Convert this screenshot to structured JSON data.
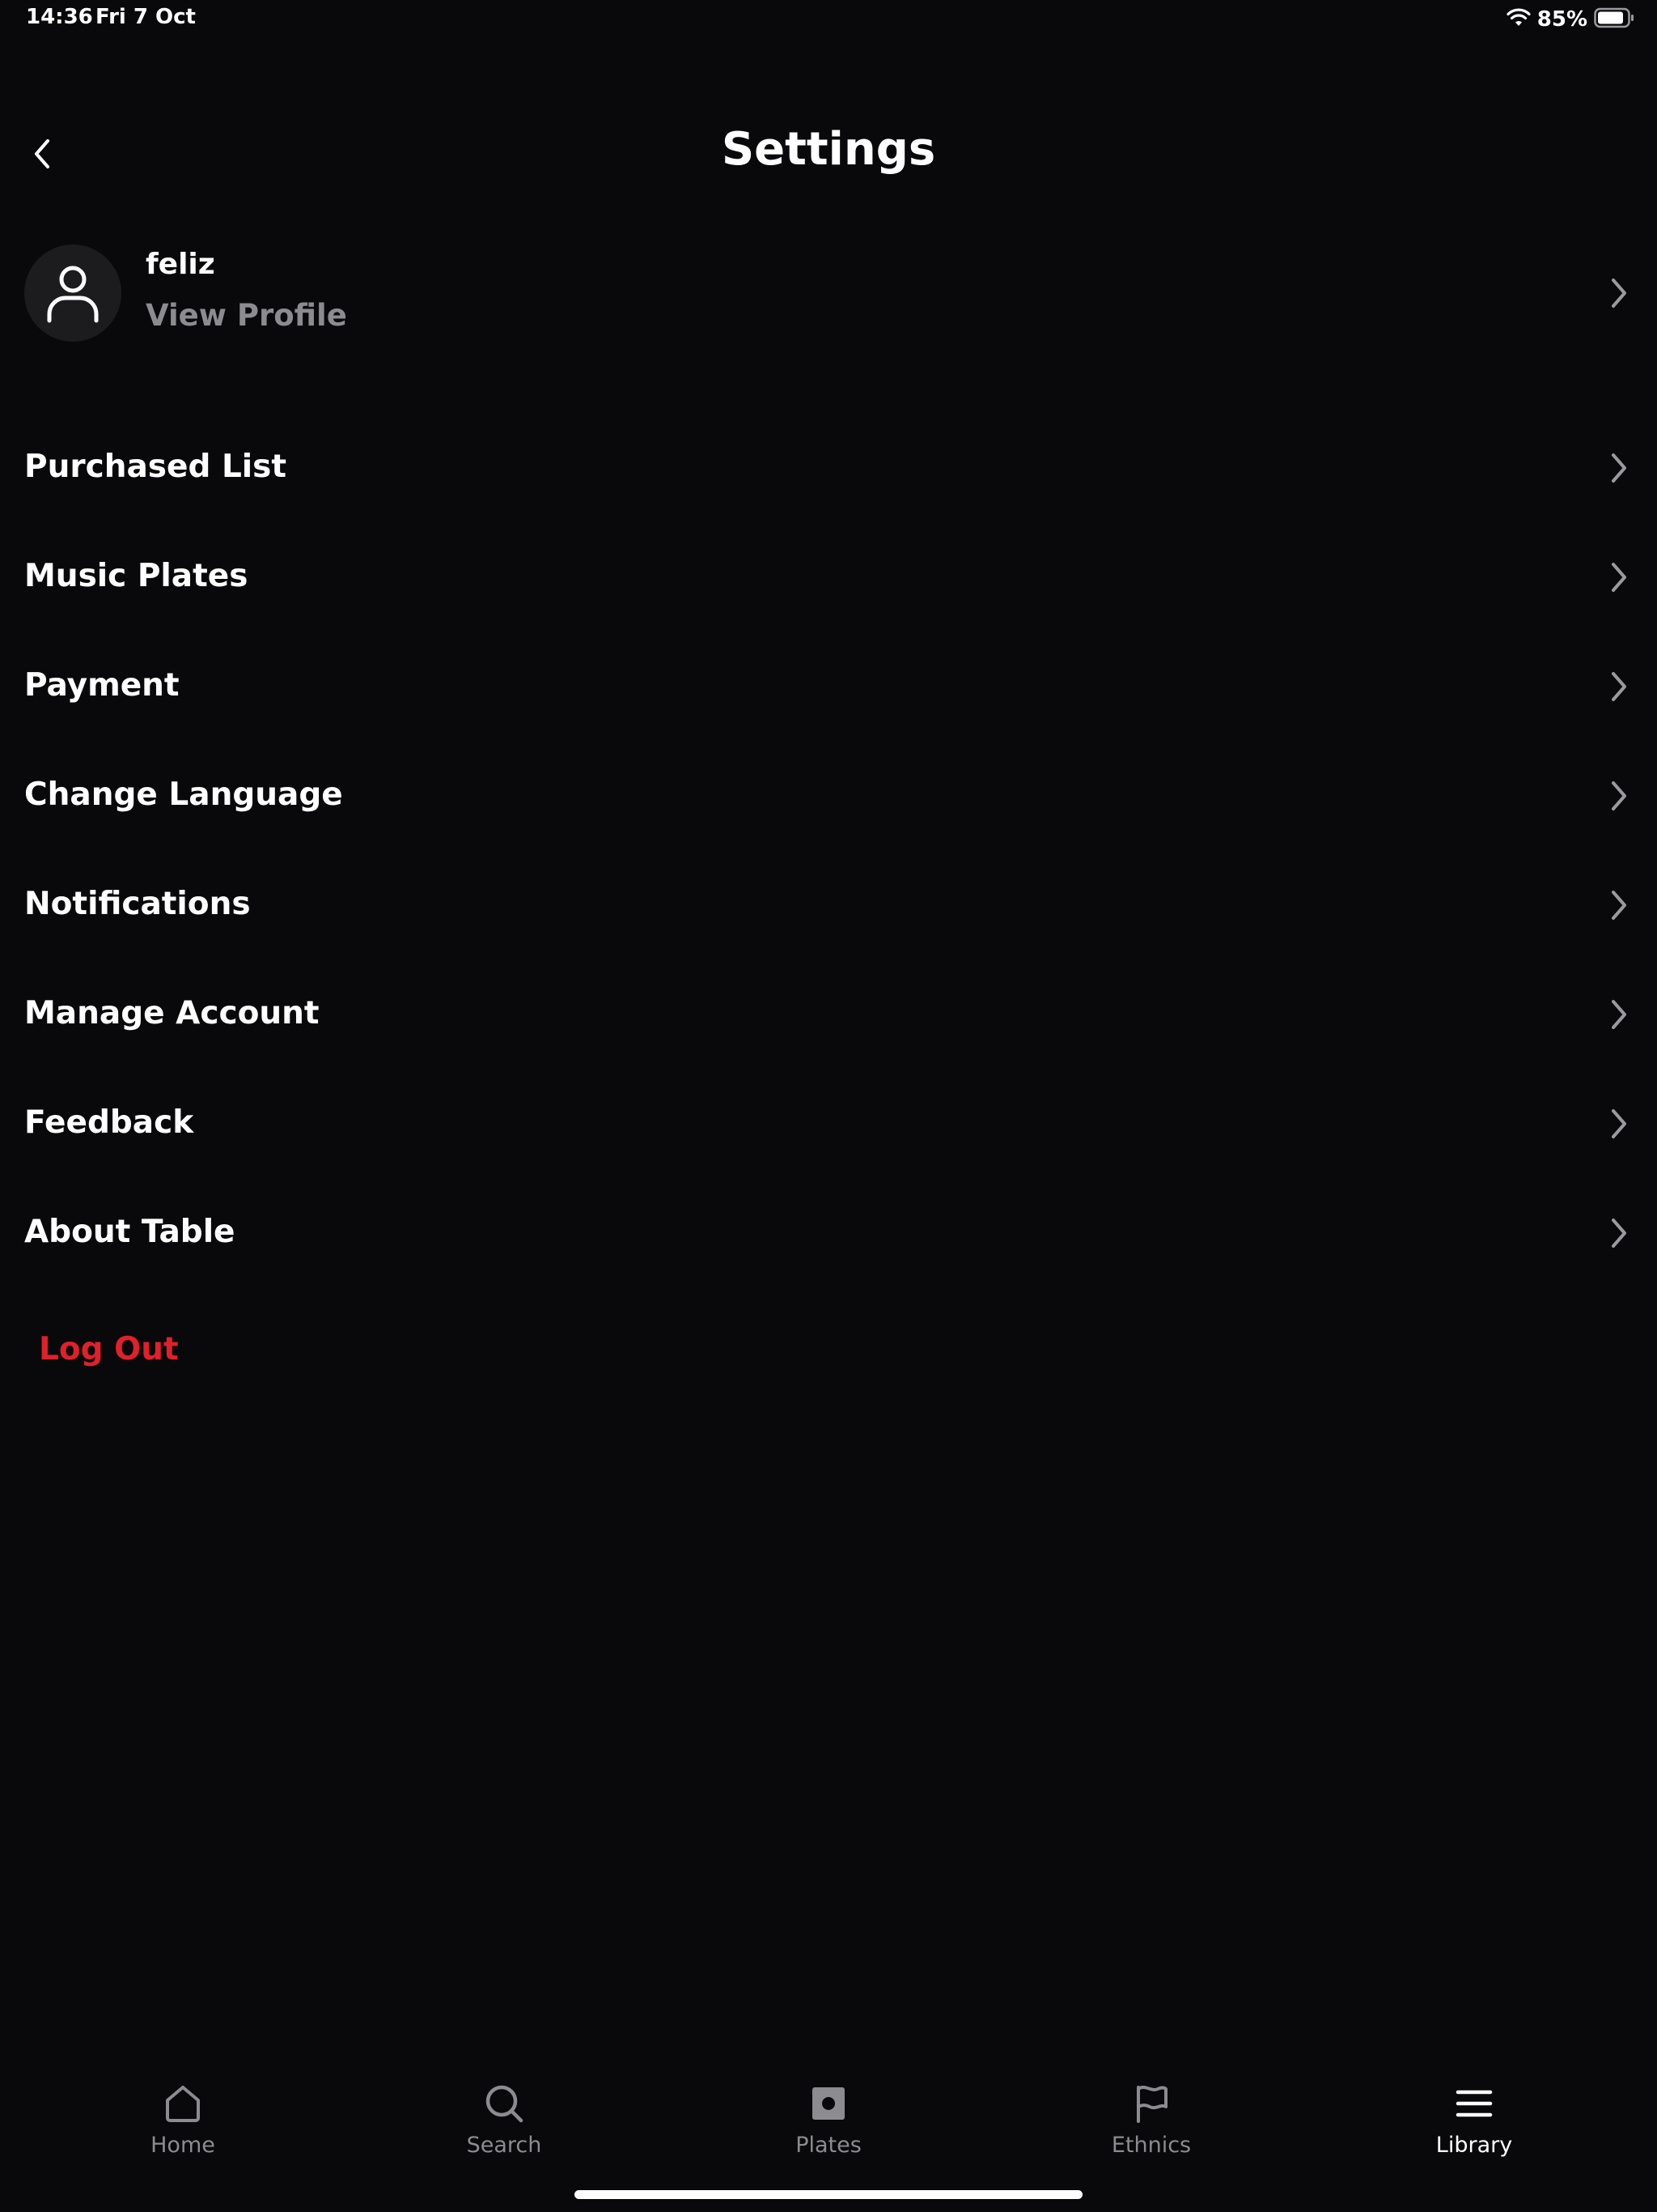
{
  "status_bar": {
    "time": "14:36",
    "date": "Fri 7 Oct",
    "battery": "85%"
  },
  "header": {
    "title": "Settings"
  },
  "profile": {
    "name": "feliz",
    "subtitle": "View Profile"
  },
  "menu": {
    "items": [
      {
        "label": "Purchased List"
      },
      {
        "label": "Music Plates"
      },
      {
        "label": "Payment"
      },
      {
        "label": "Change Language"
      },
      {
        "label": "Notifications"
      },
      {
        "label": "Manage Account"
      },
      {
        "label": "Feedback"
      },
      {
        "label": "About Table"
      }
    ],
    "logout_label": "Log Out"
  },
  "tabs": [
    {
      "label": "Home",
      "icon": "home-icon"
    },
    {
      "label": "Search",
      "icon": "search-icon"
    },
    {
      "label": "Plates",
      "icon": "plates-icon"
    },
    {
      "label": "Ethnics",
      "icon": "flag-icon"
    },
    {
      "label": "Library",
      "icon": "menu-icon",
      "active": true
    }
  ],
  "colors": {
    "background": "#09090b",
    "accent_logout": "#e0202a",
    "secondary_text": "#8b8b90"
  }
}
